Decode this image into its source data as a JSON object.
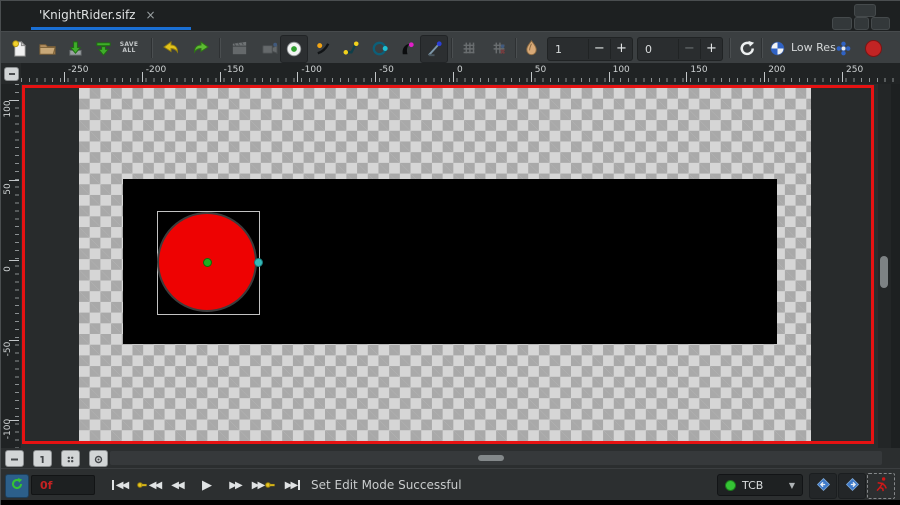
{
  "tab": {
    "title": "'KnightRider.sifz",
    "close": "×"
  },
  "toolbar": {
    "save_all_label": "SAVE ALL",
    "low_res_label": "Low Res",
    "onion_past": {
      "value": "1",
      "minus": "−",
      "plus": "+"
    },
    "onion_future": {
      "value": "0",
      "minus": "−",
      "plus": "+"
    }
  },
  "rulers": {
    "horizontal_labels": [
      "-250",
      "-200",
      "-150",
      "-100",
      "-50",
      "0",
      "50",
      "100",
      "150",
      "200",
      "250"
    ],
    "vertical_labels": [
      "100",
      "50",
      "0",
      "-50",
      "-100"
    ]
  },
  "canvas": {
    "border_color": "#e61212",
    "artboard_background": "#000000",
    "circle_fill": "#ee0202",
    "origin_handle_color": "#1fae1f",
    "radius_handle_color": "#35b8b8",
    "checker_light": "#d6d6d6",
    "checker_dark": "#a9a9a9"
  },
  "timetrack": {
    "buttons": [
      {
        "name": "timetrack-minus-button",
        "icon": "dash"
      },
      {
        "name": "onion-past-button",
        "icon": "one"
      },
      {
        "name": "onion-future-button",
        "icon": "dots"
      },
      {
        "name": "crosshair-button",
        "icon": "target"
      }
    ]
  },
  "transport": {
    "time_value": "0f",
    "status": "Set Edit Mode Successful",
    "buttons": [
      {
        "name": "seek-begin-button",
        "icon": "seek-begin"
      },
      {
        "name": "seek-prev-keyframe-button",
        "icon": "prev-key"
      },
      {
        "name": "prev-frame-button",
        "icon": "prev-frame"
      },
      {
        "name": "play-button",
        "icon": "play"
      },
      {
        "name": "next-frame-button",
        "icon": "next-frame"
      },
      {
        "name": "seek-next-keyframe-button",
        "icon": "next-key"
      },
      {
        "name": "seek-end-button",
        "icon": "seek-end"
      }
    ]
  },
  "interpolation": {
    "selected": "TCB"
  },
  "accent": {
    "tab_underline": "#1a6fd4"
  }
}
